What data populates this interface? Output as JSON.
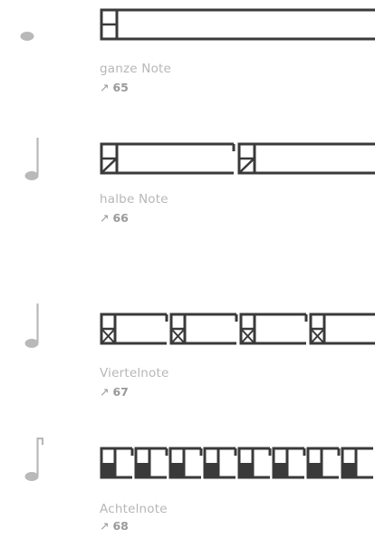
{
  "colors": {
    "glyph": "#b9b9b9",
    "box_stroke": "#3a3a3a",
    "label": "#b7b7b7",
    "ref": "#9a9a9a"
  },
  "notes": [
    {
      "id": "whole",
      "name": "ganze Note",
      "ref_arrow": "↗",
      "ref_number": "65",
      "glyph_icon": "whole-note-icon",
      "pattern_boxes": 1
    },
    {
      "id": "half",
      "name": "halbe Note",
      "ref_arrow": "↗",
      "ref_number": "66",
      "glyph_icon": "half-note-icon",
      "pattern_boxes": 2
    },
    {
      "id": "quarter",
      "name": "Viertelnote",
      "ref_arrow": "↗",
      "ref_number": "67",
      "glyph_icon": "quarter-note-icon",
      "pattern_boxes": 4
    },
    {
      "id": "eighth",
      "name": "Achtelnote",
      "ref_arrow": "↗",
      "ref_number": "68",
      "glyph_icon": "eighth-note-icon",
      "pattern_boxes": 8
    }
  ]
}
